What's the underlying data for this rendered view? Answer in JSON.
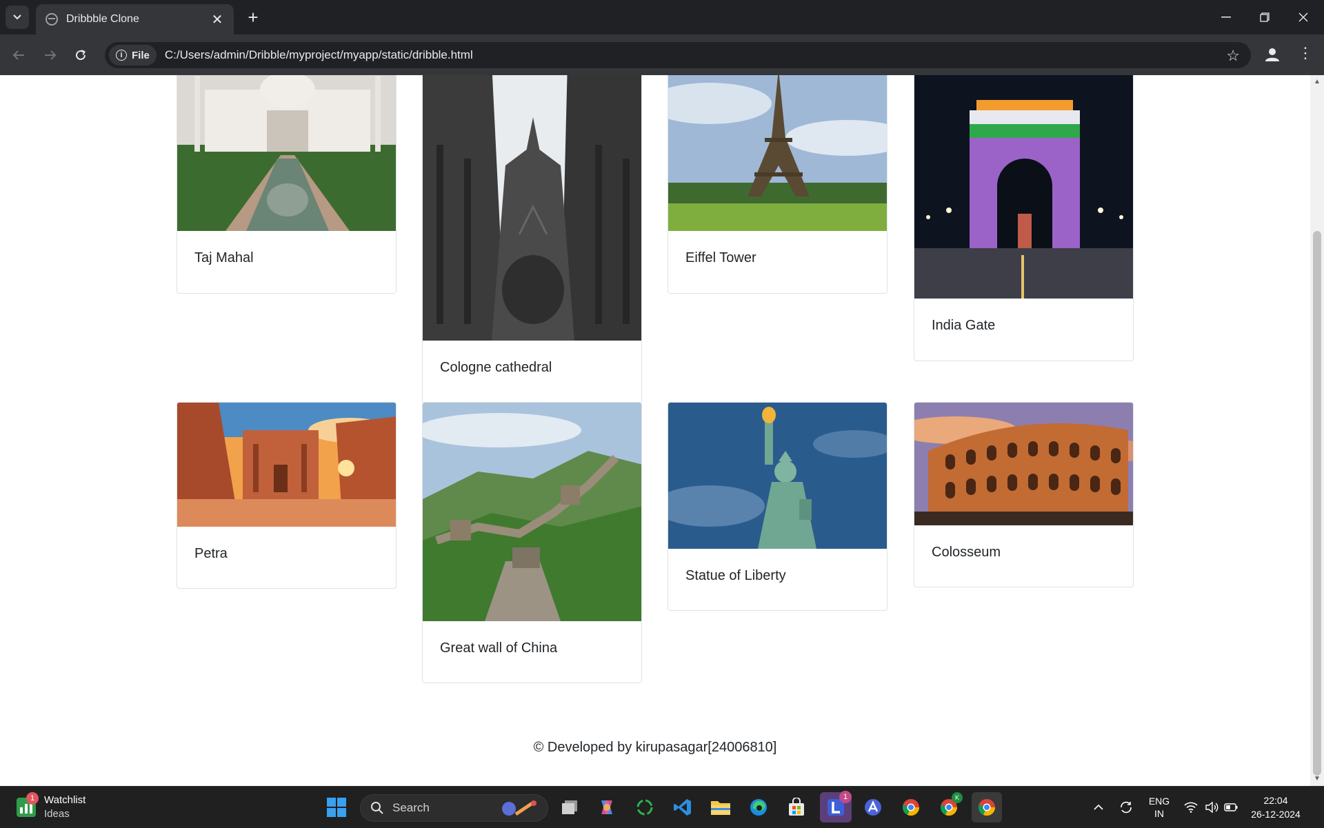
{
  "browser": {
    "tab_title": "Dribbble Clone",
    "url_chip": "File",
    "url": "C:/Users/admin/Dribble/myproject/myapp/static/dribble.html"
  },
  "cards": [
    {
      "title": "Taj Mahal",
      "icon": "taj-mahal-image"
    },
    {
      "title": "Cologne cathedral",
      "icon": "cologne-cathedral-image"
    },
    {
      "title": "Eiffel Tower",
      "icon": "eiffel-tower-image"
    },
    {
      "title": "India Gate",
      "icon": "india-gate-image"
    },
    {
      "title": "Petra",
      "icon": "petra-image"
    },
    {
      "title": "Great wall of China",
      "icon": "great-wall-image"
    },
    {
      "title": "Statue of Liberty",
      "icon": "statue-of-liberty-image"
    },
    {
      "title": "Colosseum",
      "icon": "colosseum-image"
    }
  ],
  "footer": "© Developed by kirupasagar[24006810]",
  "taskbar": {
    "widget_title": "Watchlist",
    "widget_sub": "Ideas",
    "widget_badge": "1",
    "search_placeholder": "Search",
    "lang_top": "ENG",
    "lang_bottom": "IN",
    "time": "22:04",
    "date": "26-12-2024",
    "app_badge": "1",
    "chrome_profile_badge": "K"
  }
}
